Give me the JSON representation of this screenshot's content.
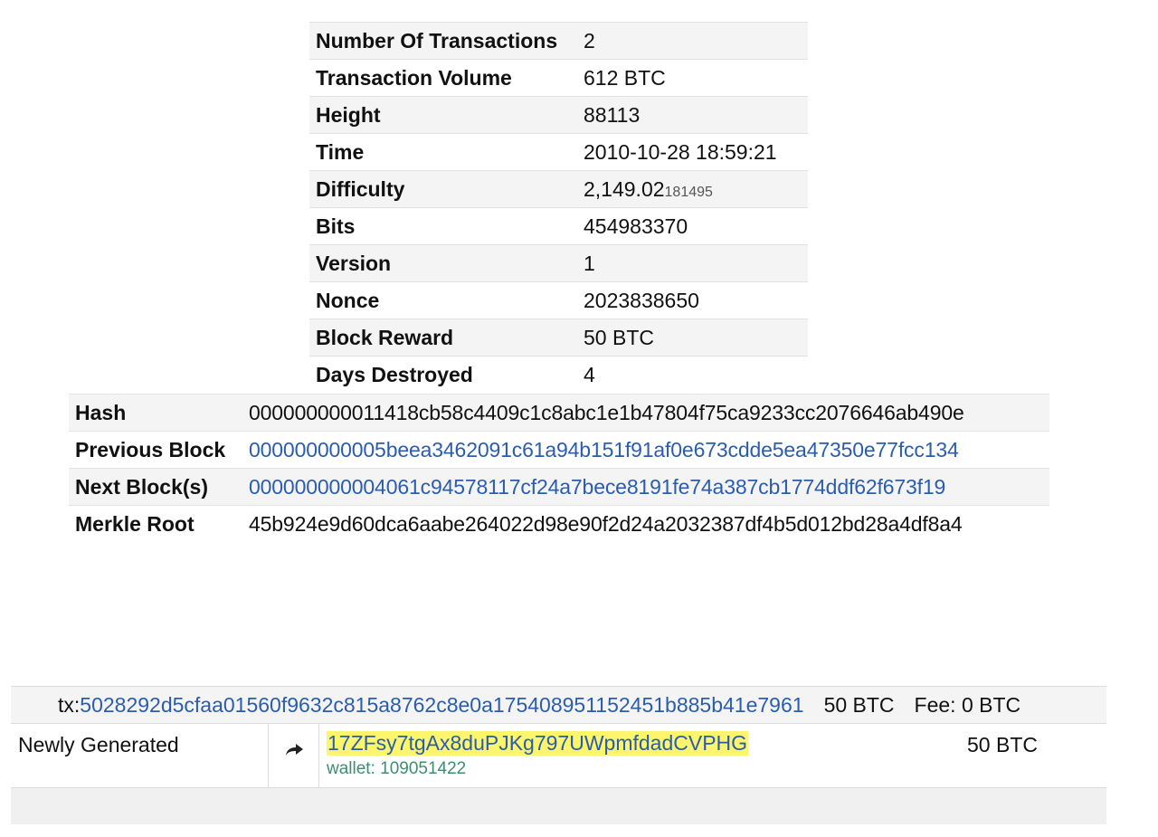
{
  "summary": {
    "rows": [
      {
        "label": "Number Of Transactions",
        "value": "2"
      },
      {
        "label": "Transaction Volume",
        "value": "612 BTC"
      },
      {
        "label": "Height",
        "value": "88113"
      },
      {
        "label": "Time",
        "value": "2010-10-28 18:59:21"
      },
      {
        "label": "Difficulty",
        "value": "2,149.02",
        "value_small": "181495"
      },
      {
        "label": "Bits",
        "value": "454983370"
      },
      {
        "label": "Version",
        "value": "1"
      },
      {
        "label": "Nonce",
        "value": "2023838650"
      },
      {
        "label": "Block Reward",
        "value": "50 BTC"
      },
      {
        "label": "Days Destroyed",
        "value": "4"
      }
    ]
  },
  "hashes": {
    "hash": {
      "label": "Hash",
      "value": "000000000011418cb58c4409c1c8abc1e1b47804f75ca9233cc2076646ab490e"
    },
    "previous_block": {
      "label": "Previous Block",
      "value": "000000000005beea3462091c61a94b151f91af0e673cdde5ea47350e77fcc134"
    },
    "next_blocks": {
      "label": "Next Block(s)",
      "value": "000000000004061c94578117cf24a7bece8191fe74a387cb1774ddf62f673f19"
    },
    "merkle_root": {
      "label": "Merkle Root",
      "value": "45b924e9d60dca6aabe264022d98e90f2d24a2032387df4b5d012bd28a4df8a4"
    }
  },
  "transaction": {
    "tx_prefix": "tx:",
    "tx_hash": "5028292d5cfaa01560f9632c815a8762c8e0a175408951152451b885b41e7961",
    "amount": "50 BTC",
    "fee": "Fee: 0 BTC",
    "from": "Newly Generated",
    "arrow_icon": "arrow-right-icon",
    "to_address": "17ZFsy7tgAx8duPJKg797UWpmfdadCVPHG",
    "wallet": "wallet: 109051422",
    "output_amount": "50 BTC"
  },
  "colors": {
    "link": "#2a5db0",
    "highlight": "#fdf56b",
    "wallet": "#3c8f6d",
    "row_alt": "#f4f4f4"
  }
}
